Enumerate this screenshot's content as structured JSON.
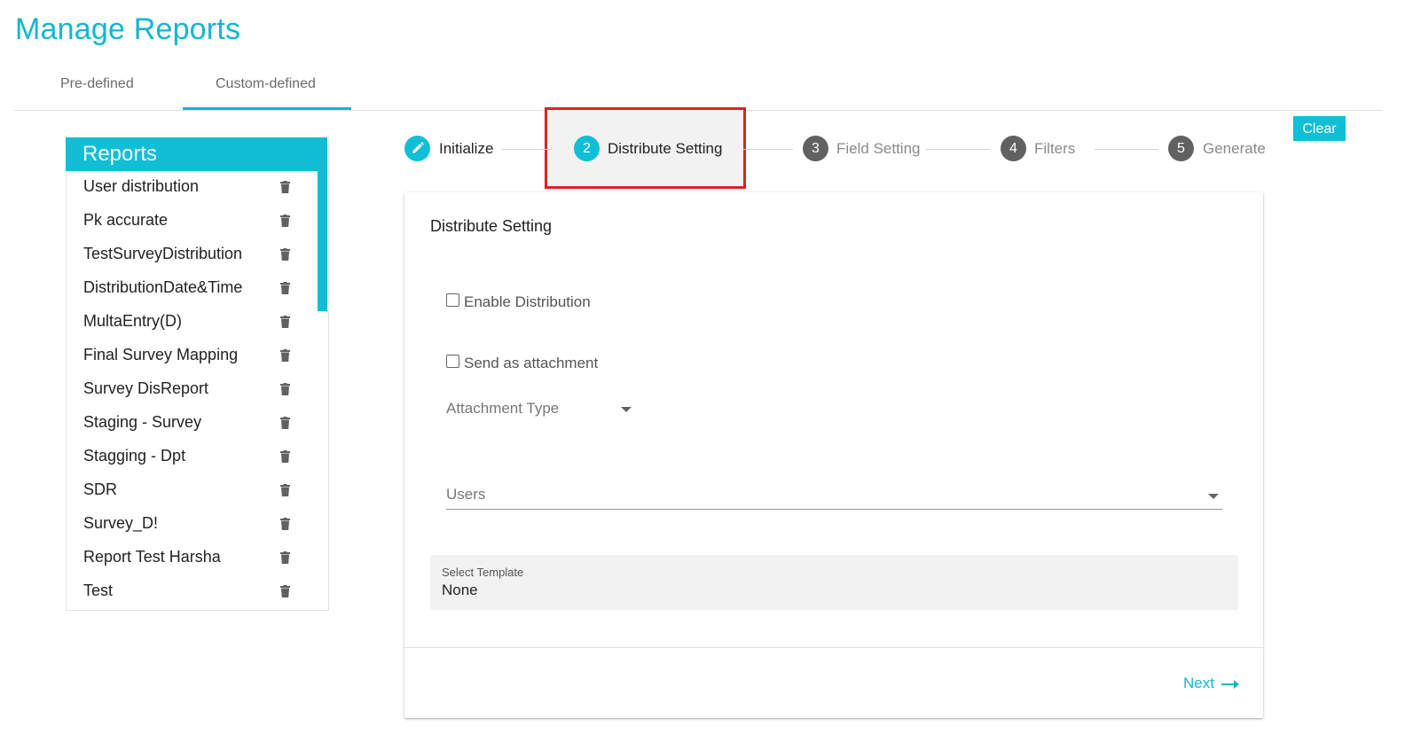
{
  "page": {
    "title": "Manage Reports"
  },
  "tabs": [
    {
      "label": "Pre-defined"
    },
    {
      "label": "Custom-defined"
    }
  ],
  "reports": {
    "header": "Reports",
    "items": [
      "User distribution",
      "Pk accurate",
      "TestSurveyDistribution",
      "DistributionDate&Time",
      "MultaEntry(D)",
      "Final Survey Mapping",
      "Survey DisReport",
      "Staging - Survey",
      "Stagging - Dpt",
      "SDR",
      "Survey_D!",
      "Report Test Harsha",
      "Test"
    ],
    "item_icon": "trash-icon"
  },
  "stepper": {
    "steps": [
      {
        "number": "",
        "label": "Initialize",
        "icon": "pencil-icon"
      },
      {
        "number": "2",
        "label": "Distribute Setting"
      },
      {
        "number": "3",
        "label": "Field Setting"
      },
      {
        "number": "4",
        "label": "Filters"
      },
      {
        "number": "5",
        "label": "Generate"
      }
    ]
  },
  "toolbar": {
    "clear_label": "Clear"
  },
  "form": {
    "title": "Distribute Setting",
    "enable_distribution_label": "Enable Distribution",
    "send_attachment_label": "Send as attachment",
    "attachment_type_label": "Attachment Type",
    "users_label": "Users",
    "template_label": "Select Template",
    "template_value": "None",
    "next_label": "Next"
  },
  "colors": {
    "accent": "#10bed6",
    "highlight": "#e01f26",
    "step_inactive": "#616161"
  }
}
